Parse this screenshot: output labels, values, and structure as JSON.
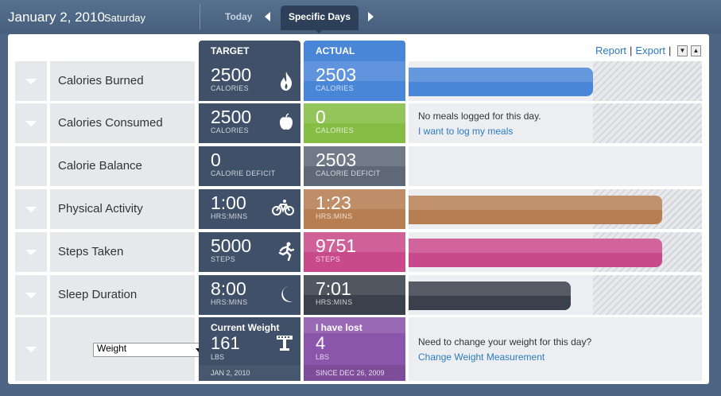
{
  "header": {
    "date": "January 2, 2010",
    "weekday": "Saturday",
    "tab_today": "Today",
    "tab_specific": "Specific Days"
  },
  "toolbar": {
    "report": "Report",
    "export": "Export",
    "separator": "|"
  },
  "columns": {
    "target": "TARGET",
    "actual": "ACTUAL"
  },
  "rows": [
    {
      "label": "Calories Burned",
      "target": "2500",
      "target_unit": "CALORIES",
      "target_icon": "flame-icon",
      "actual": "2503",
      "actual_unit": "CALORIES",
      "actual_color": "#4a86d8",
      "progress": 1.0
    },
    {
      "label": "Calories Consumed",
      "target": "2500",
      "target_unit": "CALORIES",
      "target_icon": "apple-icon",
      "actual": "0",
      "actual_unit": "CALORIES",
      "actual_color": "#86bd45",
      "message": "No meals logged for this day.",
      "link": "I want to log my meals"
    },
    {
      "label": "Calorie Balance",
      "target": "0",
      "target_unit": "CALORIE DEFICIT",
      "actual": "2503",
      "actual_unit": "CALORIE DEFICIT",
      "actual_color": "#5e6877"
    },
    {
      "label": "Physical Activity",
      "target": "1:00",
      "target_unit": "HRS:MINS",
      "target_icon": "bicycle-icon",
      "actual": "1:23",
      "actual_unit": "HRS:MINS",
      "actual_color": "#b77e52",
      "progress": 1.4
    },
    {
      "label": "Steps Taken",
      "target": "5000",
      "target_unit": "STEPS",
      "target_icon": "runner-icon",
      "actual": "9751",
      "actual_unit": "STEPS",
      "actual_color": "#c94a8a",
      "progress": 1.95
    },
    {
      "label": "Sleep Duration",
      "target": "8:00",
      "target_unit": "HRS:MINS",
      "target_icon": "moon-icon",
      "actual": "7:01",
      "actual_unit": "HRS:MINS",
      "actual_color": "#3a404c",
      "progress": 0.88
    }
  ],
  "weight": {
    "select_value": "Weight",
    "target_heading": "Current Weight",
    "target": "161",
    "target_unit": "LBS",
    "target_foot": "JAN 2, 2010",
    "target_icon": "scale-icon",
    "actual_heading": "I have lost",
    "actual": "4",
    "actual_unit": "LBS",
    "actual_foot": "SINCE DEC 26, 2009",
    "actual_color": "#8b55ab",
    "message": "Need to change your weight for this day?",
    "link": "Change Weight Measurement"
  }
}
